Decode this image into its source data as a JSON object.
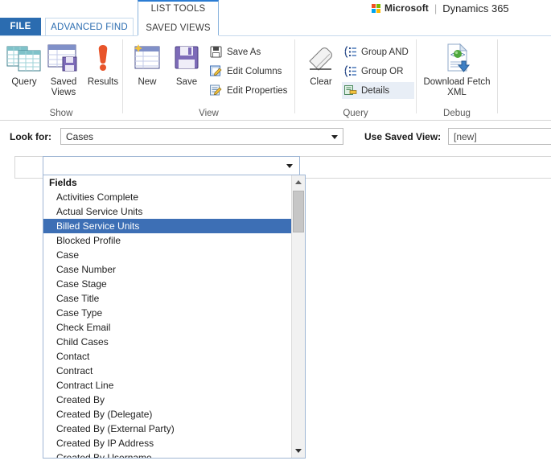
{
  "brand": {
    "microsoft": "Microsoft",
    "separator": "|",
    "product": "Dynamics 365"
  },
  "contextual_group": {
    "label": "LIST TOOLS",
    "tab": "SAVED VIEWS"
  },
  "tabs": {
    "file": "FILE",
    "advanced_find": "ADVANCED FIND"
  },
  "ribbon": {
    "groups": [
      {
        "name": "Show",
        "label": "Show"
      },
      {
        "name": "View",
        "label": "View"
      },
      {
        "name": "Query",
        "label": "Query"
      },
      {
        "name": "Debug",
        "label": "Debug"
      }
    ],
    "show": {
      "query": {
        "label": "Query",
        "icon": "table-query-icon"
      },
      "saved_views": {
        "label_line1": "Saved",
        "label_line2": "Views",
        "icon": "saved-views-icon"
      },
      "results": {
        "label": "Results",
        "icon": "exclamation-icon"
      }
    },
    "view": {
      "new": {
        "label": "New",
        "icon": "new-table-icon"
      },
      "save": {
        "label": "Save",
        "icon": "floppy-disk-icon"
      },
      "save_as": {
        "label": "Save As",
        "icon": "floppy-disk-small-icon"
      },
      "edit_columns": {
        "label": "Edit Columns",
        "icon": "edit-columns-icon"
      },
      "edit_properties": {
        "label": "Edit Properties",
        "icon": "edit-properties-icon"
      }
    },
    "query": {
      "clear": {
        "label": "Clear",
        "icon": "eraser-icon"
      },
      "group_and": {
        "label": "Group AND",
        "icon": "group-and-icon"
      },
      "group_or": {
        "label": "Group OR",
        "icon": "group-or-icon"
      },
      "details": {
        "label": "Details",
        "icon": "details-icon"
      }
    },
    "debug": {
      "download_fetch_xml": {
        "label_line1": "Download Fetch",
        "label_line2": "XML",
        "icon": "download-fetch-xml-icon"
      }
    }
  },
  "query_bar": {
    "look_for_label": "Look for:",
    "look_for_value": "Cases",
    "use_saved_view_label": "Use Saved View:",
    "use_saved_view_value": "[new]"
  },
  "attribute_picker": {
    "value": "",
    "placeholder": "",
    "dropdown_open": true,
    "selected": "Billed Service Units",
    "items": [
      {
        "label": "Fields",
        "type": "group"
      },
      {
        "label": "Activities Complete",
        "type": "item"
      },
      {
        "label": "Actual Service Units",
        "type": "item"
      },
      {
        "label": "Billed Service Units",
        "type": "item"
      },
      {
        "label": "Blocked Profile",
        "type": "item"
      },
      {
        "label": "Case",
        "type": "item"
      },
      {
        "label": "Case Number",
        "type": "item"
      },
      {
        "label": "Case Stage",
        "type": "item"
      },
      {
        "label": "Case Title",
        "type": "item"
      },
      {
        "label": "Case Type",
        "type": "item"
      },
      {
        "label": "Check Email",
        "type": "item"
      },
      {
        "label": "Child Cases",
        "type": "item"
      },
      {
        "label": "Contact",
        "type": "item"
      },
      {
        "label": "Contract",
        "type": "item"
      },
      {
        "label": "Contract Line",
        "type": "item"
      },
      {
        "label": "Created By",
        "type": "item"
      },
      {
        "label": "Created By (Delegate)",
        "type": "item"
      },
      {
        "label": "Created By (External Party)",
        "type": "item"
      },
      {
        "label": "Created By IP Address",
        "type": "item"
      },
      {
        "label": "Created By Username",
        "type": "item"
      }
    ]
  },
  "colors": {
    "file_tab": "#2b6cb0",
    "active_tab_text": "#2b6cb0",
    "selection": "#3d6fb5",
    "results_icon": "#e8542a",
    "contextual_border": "#2b7cd3"
  }
}
